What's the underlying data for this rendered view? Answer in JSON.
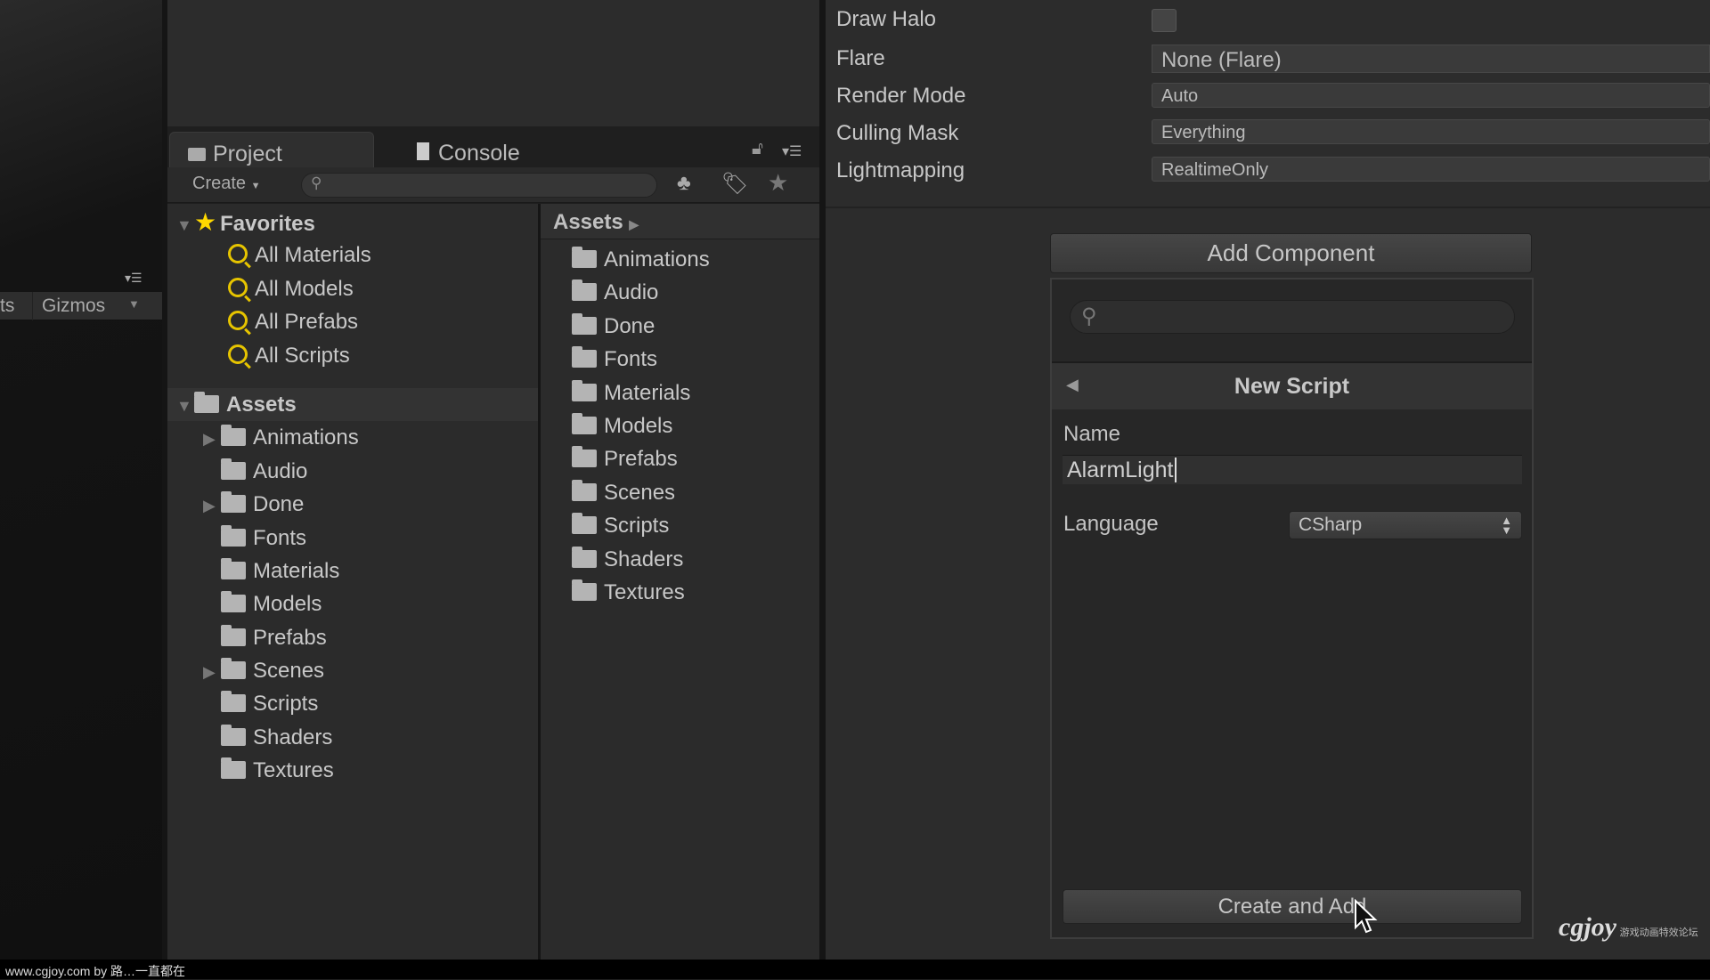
{
  "scene": {
    "toolbar_partial": "ts",
    "gizmos": "Gizmos"
  },
  "project_window": {
    "tabs": [
      {
        "label": "Project",
        "icon": "folder-icon"
      },
      {
        "label": "Console",
        "icon": "console-icon"
      }
    ],
    "create_label": "Create",
    "favorites": {
      "label": "Favorites",
      "items": [
        "All Materials",
        "All Models",
        "All Prefabs",
        "All Scripts"
      ]
    },
    "assets": {
      "label": "Assets",
      "items": [
        {
          "label": "Animations",
          "expandable": true
        },
        {
          "label": "Audio",
          "expandable": false
        },
        {
          "label": "Done",
          "expandable": true
        },
        {
          "label": "Fonts",
          "expandable": false
        },
        {
          "label": "Materials",
          "expandable": false
        },
        {
          "label": "Models",
          "expandable": false
        },
        {
          "label": "Prefabs",
          "expandable": false
        },
        {
          "label": "Scenes",
          "expandable": true
        },
        {
          "label": "Scripts",
          "expandable": false
        },
        {
          "label": "Shaders",
          "expandable": false
        },
        {
          "label": "Textures",
          "expandable": false
        }
      ]
    },
    "breadcrumb": "Assets",
    "folder_list": [
      "Animations",
      "Audio",
      "Done",
      "Fonts",
      "Materials",
      "Models",
      "Prefabs",
      "Scenes",
      "Scripts",
      "Shaders",
      "Textures"
    ]
  },
  "inspector": {
    "properties": [
      {
        "label": "Draw Halo",
        "type": "checkbox",
        "checked": false
      },
      {
        "label": "Flare",
        "value": "None (Flare)"
      },
      {
        "label": "Render Mode",
        "value": "Auto"
      },
      {
        "label": "Culling Mask",
        "value": "Everything"
      },
      {
        "label": "Lightmapping",
        "value": "RealtimeOnly"
      }
    ],
    "add_component": "Add Component",
    "popup": {
      "title": "New Script",
      "name_label": "Name",
      "name_value": "AlarmLight",
      "language_label": "Language",
      "language_value": "CSharp",
      "create_button": "Create and Add"
    }
  },
  "footer": "www.cgjoy.com by 路…一直都在",
  "watermark": "cgjoy 游戏动画特效论坛 www.cgjoy.com",
  "colors": {
    "favorites_icon": "#e6c400",
    "background": "#2b2b2b"
  }
}
